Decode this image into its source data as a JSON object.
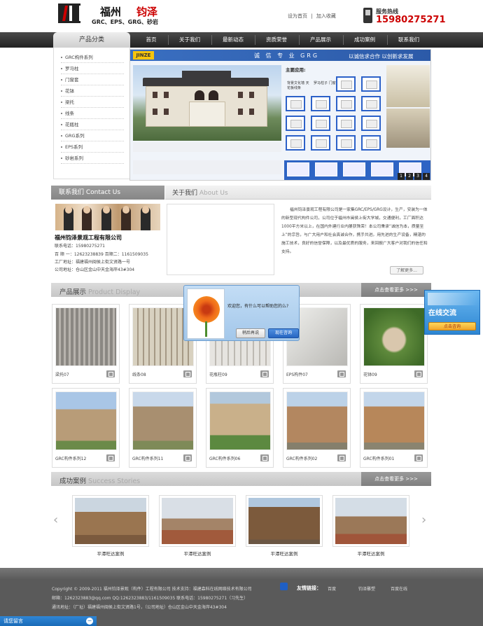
{
  "header": {
    "logo_name_part1": "福州",
    "logo_name_part2": "钧泽",
    "logo_sub": "GRC、EPS、GRG、砂岩",
    "link_home": "设为首页",
    "link_sep": "|",
    "link_fav": "加入收藏",
    "hotline_label": "服务热线",
    "hotline_number": "15980275271"
  },
  "nav": {
    "category_title": "产品分类",
    "items": [
      "首页",
      "关于我们",
      "最新动态",
      "资质荣誉",
      "产品展示",
      "成功案例",
      "联系我们"
    ]
  },
  "sidebar": {
    "items": [
      "GRC构件系列",
      "罗马柱",
      "门窗套",
      "花钵",
      "梁托",
      "线条",
      "花瓶柱",
      "GRG系列",
      "EPS系列",
      "砂岩系列"
    ]
  },
  "banner": {
    "logo": "JINZE",
    "slogan_center": "诚 信 专 业   GRG",
    "slogan_right": "以诚信求合作  以创新求发展",
    "app_title": "主要应用:",
    "app_labels": [
      "背景文化墙 天花板线条",
      "罗马柱子 门窗"
    ],
    "pages": [
      "1",
      "2",
      "3",
      "4"
    ]
  },
  "contact": {
    "header": "联系我们 Contact Us",
    "company": "福州钧泽景观工程有限公司",
    "lines": [
      "联系电话：15980275271",
      "百 顺 一：12623238839  百顺二：1161509035",
      "工厂地址：福建福州闽侯上街文贤路一号",
      "公司地址：仓山区金山中天金海岸43#304"
    ]
  },
  "about": {
    "title": "关于我们",
    "title_en": "About Us",
    "text": "福州钧泽景观工程有限公司是一家集GRC/EPS/GRG设计，生产，安装为一体的新型现代构件公司，公司位于福州市闽侯上街大学城，交通便利，工厂面积达1000平方米以上，在国内外建行业内屡获殊荣！本公司秉承“诚信为本，质量至上”的宗旨，与广大用户和社会真诚合作，携手共进。用先进的生产设备，精湛的施工技术，良好的信誉保障，以及最优质的服务，来回报广大客户对我们的信任和支持。",
    "more": "了解更多..."
  },
  "products": {
    "title": "产品展示",
    "title_en": "Product Display",
    "more": "点击查看更多 >>>",
    "items": [
      "梁托07",
      "线条08",
      "花瓶柱09",
      "EPS构件07",
      "花钵09",
      "GRC构件系列12",
      "GRC构件系列11",
      "GRC构件系列06",
      "GRC构件系列02",
      "GRC构件系列01"
    ]
  },
  "cases": {
    "title": "成功案例",
    "title_en": "Success Stories",
    "more": "点击查看更多 >>>",
    "items": [
      "平潭旺达案例",
      "平潭旺达案例",
      "平潭旺达案例",
      "平潭旺达案例"
    ]
  },
  "footer": {
    "line1": "Copyright © 2009-2011 福州钧泽景观（构件）工程有限公司 技术支持：福建森科在线网络技术有限公司",
    "line2": "邮箱：1262323883@qq.com QQ:1262323883/1161509035 联系电话：15980275271（习先生）",
    "line3": "通讯地址：（厂址）福建福州闽侯上街文贤路1号，（公司地址）仓山区金山中天金海岸43#304",
    "links_label": "友情链接：",
    "links": [
      "百度",
      "钧泽雕塑",
      "百度在线"
    ]
  },
  "chat": {
    "text": "欢迎您，有什么可以帮助您的么?",
    "later": "稍后再说",
    "now": "现在咨询"
  },
  "online": {
    "title": "在线交流",
    "button": "点击咨询"
  },
  "msgbar": {
    "label": "请您留言",
    "min": "−"
  },
  "colors": {
    "accent_red": "#cc0000",
    "nav_dark": "#2a2a2a",
    "banner_blue": "#2c5aa8",
    "chat_blue": "#a3c7ea"
  }
}
